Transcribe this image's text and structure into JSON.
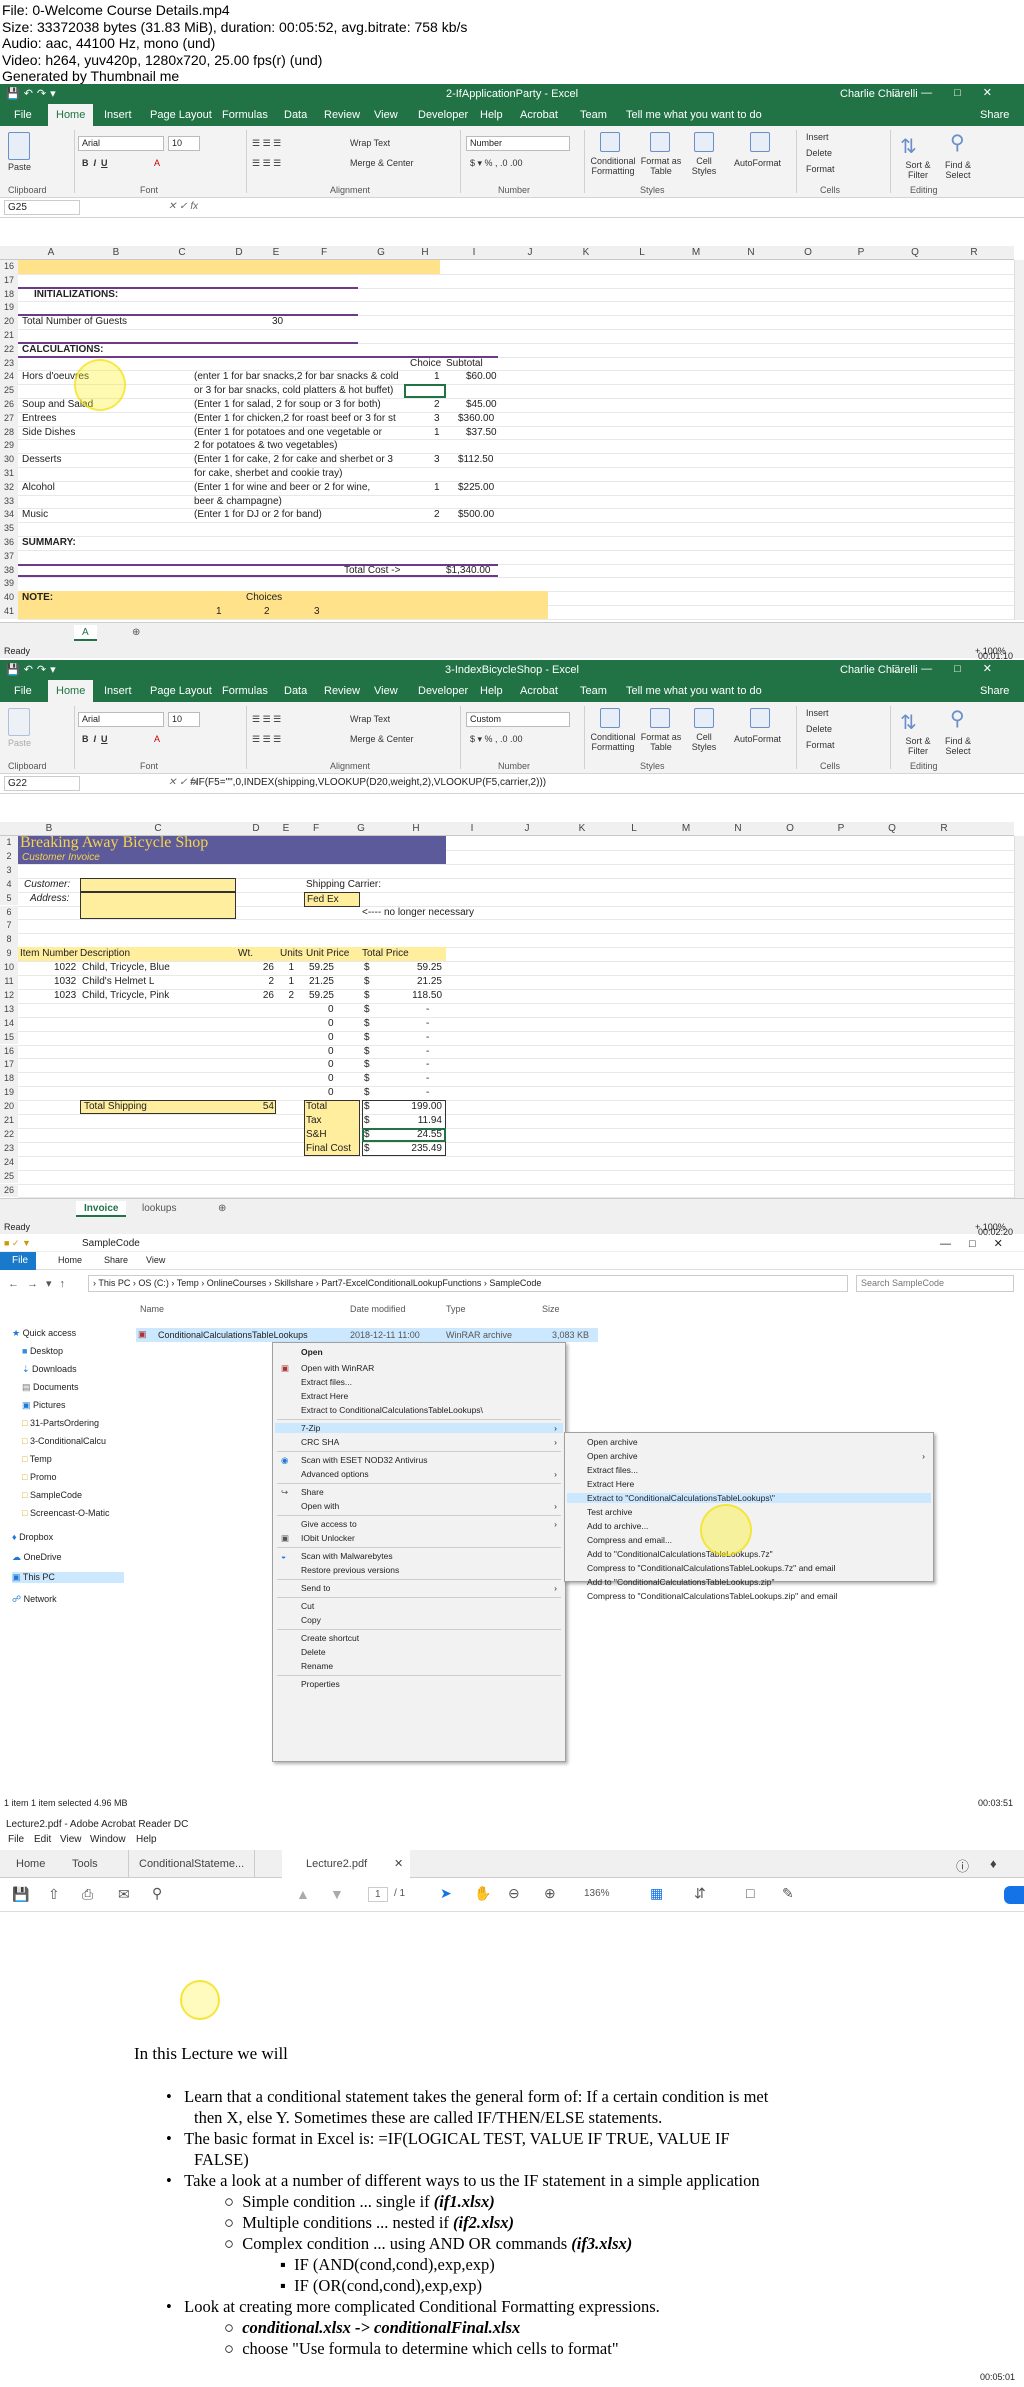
{
  "header": {
    "lines": [
      "File: 0-Welcome  Course Details.mp4",
      "Size: 33372038 bytes (31.83 MiB), duration: 00:05:52, avg.bitrate: 758 kb/s",
      "Audio: aac, 44100 Hz, mono (und)",
      "Video: h264, yuv420p, 1280x720, 25.00 fps(r) (und)",
      "Generated by Thumbnail me"
    ]
  },
  "excel1": {
    "title": "2-IfApplicationParty  -  Excel",
    "user": "Charlie Chiarelli",
    "tabs": [
      "File",
      "Home",
      "Insert",
      "Page Layout",
      "Formulas",
      "Data",
      "Review",
      "View",
      "Developer",
      "Help",
      "Acrobat",
      "Team",
      "Tell me what you want to do",
      "Share"
    ],
    "ribbon": {
      "font": "Arial",
      "size": "10",
      "wrap": "Wrap Text",
      "merge": "Merge & Center",
      "numfmt": "Number",
      "cond": "Conditional Formatting",
      "fmtTable": "Format as Table",
      "cellStyles": "Cell Styles",
      "autofmt": "AutoFormat",
      "insert": "Insert",
      "delete": "Delete",
      "format": "Format",
      "sort": "Sort & Filter",
      "find": "Find & Select",
      "groups": [
        "Clipboard",
        "Font",
        "Alignment",
        "Number",
        "Styles",
        "Cells",
        "Editing"
      ],
      "paste": "Paste"
    },
    "namebox": "G25",
    "formula": "",
    "cols": [
      "A",
      "B",
      "C",
      "D",
      "E",
      "F",
      "G",
      "H",
      "I",
      "J",
      "K",
      "L",
      "M",
      "N",
      "O",
      "P",
      "Q",
      "R"
    ],
    "rows": [
      "16",
      "17",
      "18",
      "19",
      "20",
      "21",
      "22",
      "23",
      "24",
      "25",
      "26",
      "27",
      "28",
      "29",
      "30",
      "31",
      "32",
      "33",
      "34",
      "35",
      "36",
      "37",
      "38",
      "39",
      "40",
      "41"
    ],
    "cells": {
      "init": "INITIALIZATIONS:",
      "guests": "Total Number of Guests",
      "guestsVal": "30",
      "calc": "CALCULATIONS:",
      "choice": "Choice",
      "subtotal": "Subtotal",
      "hors": "Hors d'oeuvres",
      "horsDesc": "(enter 1 for bar snacks,2 for bar snacks & cold",
      "horsDesc2": "or 3 for bar snacks, cold platters & hot buffet)",
      "horsC": "1",
      "horsS": "$60.00",
      "soup": "Soup and Salad",
      "soupDesc": "(Enter 1 for salad, 2 for soup or 3 for both)",
      "soupC": "2",
      "soupS": "$45.00",
      "entrees": "Entrees",
      "entDesc": "(Enter 1 for chicken,2 for roast beef or 3 for st",
      "entC": "3",
      "entS": "$360.00",
      "side": "Side Dishes",
      "sideDesc": "(Enter 1 for potatoes and one vegetable or",
      "sideDesc2": "2 for potatoes & two vegetables)",
      "sideC": "1",
      "sideS": "$37.50",
      "dess": "Desserts",
      "dessDesc": "(Enter 1 for cake, 2 for cake and sherbet or 3",
      "dessDesc2": "for cake, sherbet and cookie tray)",
      "dessC": "3",
      "dessS": "$112.50",
      "alc": "Alcohol",
      "alcDesc": "(Enter 1 for wine and beer or 2 for wine,",
      "alcDesc2": "beer & champagne)",
      "alcC": "1",
      "alcS": "$225.00",
      "music": "Music",
      "musicDesc": "(Enter 1 for DJ or 2 for band)",
      "musicC": "2",
      "musicS": "$500.00",
      "summary": "SUMMARY:",
      "totalCost": "Total Cost ->",
      "totalVal": "$1,340.00",
      "note": "NOTE:",
      "choices": "Choices",
      "r41a": "1",
      "r41b": "2",
      "r41c": "3"
    },
    "sheet": "A",
    "status": "Ready",
    "zoom": "+ 100%"
  },
  "excel2": {
    "title": "3-IndexBicycleShop  -  Excel",
    "user": "Charlie Chiarelli",
    "numfmt": "Custom",
    "namebox": "G22",
    "formula": "=IF(F5=\"\",0,INDEX(shipping,VLOOKUP(D20,weight,2),VLOOKUP(F5,carrier,2)))",
    "cols": [
      "B",
      "C",
      "D",
      "E",
      "F",
      "G",
      "H",
      "I",
      "J",
      "K",
      "L",
      "M",
      "N",
      "O",
      "P",
      "Q",
      "R"
    ],
    "rows": [
      "1",
      "2",
      "3",
      "4",
      "5",
      "6",
      "7",
      "8",
      "9",
      "10",
      "11",
      "12",
      "13",
      "14",
      "15",
      "16",
      "17",
      "18",
      "19",
      "20",
      "21",
      "22",
      "23",
      "24",
      "25",
      "26"
    ],
    "shop": "Breaking Away Bicycle Shop",
    "invoice": "Customer Invoice",
    "customer": "Customer:",
    "address": "Address:",
    "shipping": "Shipping Carrier:",
    "carrier": "Fed Ex",
    "noLonger": "<---- no longer necessary",
    "head": [
      "Item Number",
      "Description",
      "Wt.",
      "Units",
      "Unit Price",
      "Total Price"
    ],
    "items": [
      [
        "1022",
        "Child, Tricycle, Blue",
        "26",
        "1",
        "59.25",
        "$",
        "59.25"
      ],
      [
        "1032",
        "Child's Helmet L",
        "2",
        "1",
        "21.25",
        "$",
        "21.25"
      ],
      [
        "1023",
        "Child, Tricycle, Pink",
        "26",
        "2",
        "59.25",
        "$",
        "118.50"
      ]
    ],
    "zero": "0",
    "dollar": "$",
    "dash": "-",
    "totalShipping": "Total Shipping",
    "shipWt": "54",
    "totals": [
      [
        "Total",
        "$",
        "199.00"
      ],
      [
        "Tax",
        "$",
        "11.94"
      ],
      [
        "S&H",
        "$",
        "24.55"
      ],
      [
        "Final Cost",
        "$",
        "235.49"
      ]
    ],
    "sheets": [
      "Invoice",
      "lookups"
    ],
    "status": "Ready",
    "zoom": "+ 100%"
  },
  "explorer": {
    "title": "SampleCode",
    "tabs": [
      "File",
      "Home",
      "Share",
      "View"
    ],
    "path": [
      "This PC",
      "OS (C:)",
      "Temp",
      "OnlineCourses",
      "Skillshare",
      "Part7-ExcelConditionalLookupFunctions",
      "SampleCode"
    ],
    "search": "Search SampleCode",
    "cols": [
      "Name",
      "Date modified",
      "Type",
      "Size"
    ],
    "file": "ConditionalCalculationsTableLookups",
    "fileDate": "2018-12-11 11:00",
    "fileType": "WinRAR archive",
    "fileSize": "3,083 KB",
    "nav": [
      "Quick access",
      "Desktop",
      "Downloads",
      "Documents",
      "Pictures",
      "31-PartsOrdering",
      "3-ConditionalCalcu",
      "Temp",
      "Promo",
      "SampleCode",
      "Screencast-O-Matic",
      "Dropbox",
      "OneDrive",
      "This PC",
      "Network"
    ],
    "menu": [
      "Open",
      "Open with WinRAR",
      "Extract files...",
      "Extract Here",
      "Extract to ConditionalCalculationsTableLookups\\",
      "7-Zip",
      "CRC SHA",
      "Scan with ESET NOD32 Antivirus",
      "Advanced options",
      "Share",
      "Open with",
      "Give access to",
      "IObit Unlocker",
      "Scan with Malwarebytes",
      "Restore previous versions",
      "Send to",
      "Cut",
      "Copy",
      "Create shortcut",
      "Delete",
      "Rename",
      "Properties"
    ],
    "sub": [
      "Open archive",
      "Open archive",
      "Extract files...",
      "Extract Here",
      "Extract to \"ConditionalCalculationsTableLookups\\\"",
      "Test archive",
      "Add to archive...",
      "Compress and email...",
      "Add to \"ConditionalCalculationsTableLookups.7z\"",
      "Compress to \"ConditionalCalculationsTableLookups.7z\" and email",
      "Add to \"ConditionalCalculationsTableLookups.zip\"",
      "Compress to \"ConditionalCalculationsTableLookups.zip\" and email"
    ],
    "status": "1 item    1 item selected  4.96 MB",
    "ts": "00:03:51"
  },
  "pdf": {
    "title": "Lecture2.pdf - Adobe Acrobat Reader DC",
    "menu": [
      "File",
      "Edit",
      "View",
      "Window",
      "Help"
    ],
    "tabs": [
      "Home",
      "Tools",
      "ConditionalStateme...",
      "Lecture2.pdf"
    ],
    "page": "1",
    "pages": "/ 1",
    "zoom": "136%",
    "heading": "In this Lecture we will",
    "b1": "Learn that a conditional statement takes the general form of: If a certain condition is met",
    "b1b": "then X, else Y.  Sometimes these are called IF/THEN/ELSE statements.",
    "b2": "The basic format in Excel is: =IF(LOGICAL TEST, VALUE IF TRUE, VALUE IF",
    "b2b": "FALSE)",
    "b3": "Take a look at a number of different ways to us the IF statement in a simple application",
    "s1a": "Simple  condition ... single if  ",
    "s1b": "(if1.xlsx)",
    "s2a": "Multiple conditions ... nested if ",
    "s2b": "(if2.xlsx)",
    "s3a": "Complex condition ... using AND OR commands ",
    "s3b": "(if3.xlsx)",
    "ss1": "IF (AND(cond,cond),exp,exp)",
    "ss2": "IF (OR(cond,cond),exp,exp)",
    "b4": "Look at creating more complicated Conditional Formatting expressions.",
    "s4": "conditional.xlsx -> conditionalFinal.xlsx",
    "s5": "choose \"Use formula to determine which cells to format\"",
    "ts": "00:05:01"
  },
  "ts1": "00:01:10",
  "ts2": "00:02:20"
}
